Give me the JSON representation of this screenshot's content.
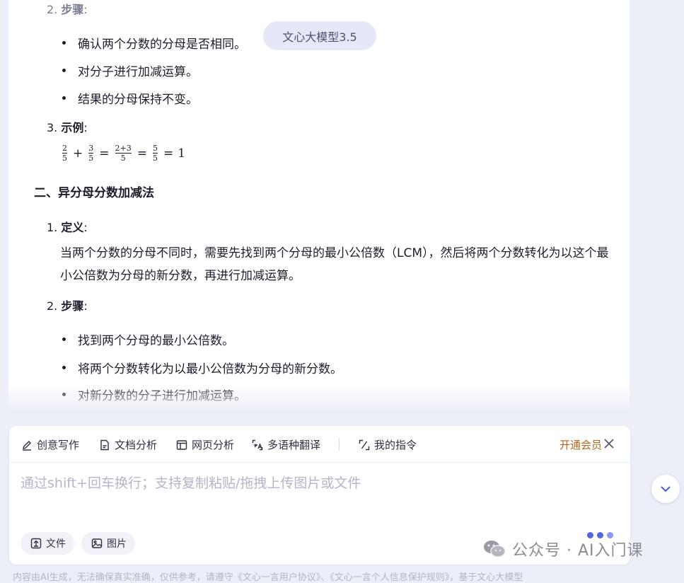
{
  "model_badge": "文心大模型3.5",
  "answer": {
    "section1_step2_prefix": "2.",
    "section1_step2_title": "步骤",
    "section1_step2_colon": ":",
    "section1_bullets": [
      "确认两个分数的分母是否相同。",
      "对分子进行加减运算。",
      "结果的分母保持不变。"
    ],
    "section1_example_prefix": "3.",
    "section1_example_title": "示例",
    "section1_example_colon": ":",
    "math": {
      "f1_num": "2",
      "f1_den": "5",
      "plus": "+",
      "f2_num": "3",
      "f2_den": "5",
      "eq1": "=",
      "f3_num": "2+3",
      "f3_den": "5",
      "eq2": "=",
      "f4_num": "5",
      "f4_den": "5",
      "eq3": "=",
      "result": "1"
    },
    "section2_heading": "二、异分母分数加减法",
    "section2_def_prefix": "1.",
    "section2_def_title": "定义",
    "section2_def_colon": ":",
    "section2_def_text": "当两个分数的分母不同时，需要先找到两个分母的最小公倍数（LCM），然后将两个分数转化为以这个最小公倍数为分母的新分数，再进行加减运算。",
    "section2_step_prefix": "2.",
    "section2_step_title": "步骤",
    "section2_step_colon": ":",
    "section2_bullets": [
      "找到两个分母的最小公倍数。",
      "将两个分数转化为以最小公倍数为分母的新分数。",
      "对新分数的分子进行加减运算。"
    ]
  },
  "toolbar": {
    "items": [
      "创意写作",
      "文档分析",
      "网页分析",
      "多语种翻译",
      "我的指令"
    ],
    "vip_label": "开通会员"
  },
  "input": {
    "placeholder": "通过shift+回车换行；支持复制粘贴/拖拽上传图片或文件",
    "value": ""
  },
  "attach": {
    "file_label": "文件",
    "image_label": "图片"
  },
  "watermark": "公众号 · AI入门课",
  "disclaimer": "内容由AI生成，无法确保真实准确，仅供参考，请遵守《文心一言用户协议》、《文心一言个人信息保护规则》，基于文心大模型"
}
